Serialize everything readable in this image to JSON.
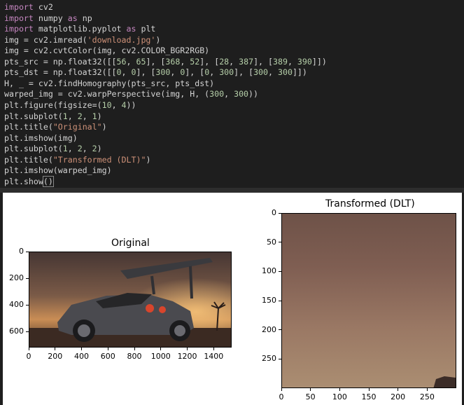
{
  "code": {
    "lines": [
      [
        [
          "kw",
          "import"
        ],
        [
          "txt",
          " cv2"
        ]
      ],
      [
        [
          "kw",
          "import"
        ],
        [
          "txt",
          " numpy "
        ],
        [
          "kw",
          "as"
        ],
        [
          "txt",
          " np"
        ]
      ],
      [
        [
          "kw",
          "import"
        ],
        [
          "txt",
          " matplotlib.pyplot "
        ],
        [
          "kw",
          "as"
        ],
        [
          "txt",
          " plt"
        ]
      ],
      [
        [
          "txt",
          "img = cv2.imread("
        ],
        [
          "st",
          "'download.jpg'"
        ],
        [
          "txt",
          ")"
        ]
      ],
      [
        [
          "txt",
          "img = cv2.cvtColor(img, cv2.COLOR_BGR2RGB)"
        ]
      ],
      [
        [
          "txt",
          "pts_src = np.float32([["
        ],
        [
          "nm",
          "56"
        ],
        [
          "txt",
          ", "
        ],
        [
          "nm",
          "65"
        ],
        [
          "txt",
          "], ["
        ],
        [
          "nm",
          "368"
        ],
        [
          "txt",
          ", "
        ],
        [
          "nm",
          "52"
        ],
        [
          "txt",
          "], ["
        ],
        [
          "nm",
          "28"
        ],
        [
          "txt",
          ", "
        ],
        [
          "nm",
          "387"
        ],
        [
          "txt",
          "], ["
        ],
        [
          "nm",
          "389"
        ],
        [
          "txt",
          ", "
        ],
        [
          "nm",
          "390"
        ],
        [
          "txt",
          "]])"
        ]
      ],
      [
        [
          "txt",
          "pts_dst = np.float32([["
        ],
        [
          "nm",
          "0"
        ],
        [
          "txt",
          ", "
        ],
        [
          "nm",
          "0"
        ],
        [
          "txt",
          "], ["
        ],
        [
          "nm",
          "300"
        ],
        [
          "txt",
          ", "
        ],
        [
          "nm",
          "0"
        ],
        [
          "txt",
          "], ["
        ],
        [
          "nm",
          "0"
        ],
        [
          "txt",
          ", "
        ],
        [
          "nm",
          "300"
        ],
        [
          "txt",
          "], ["
        ],
        [
          "nm",
          "300"
        ],
        [
          "txt",
          ", "
        ],
        [
          "nm",
          "300"
        ],
        [
          "txt",
          "]])"
        ]
      ],
      [
        [
          "txt",
          "H, _ = cv2.findHomography(pts_src, pts_dst)"
        ]
      ],
      [
        [
          "txt",
          "warped_img = cv2.warpPerspective(img, H, ("
        ],
        [
          "nm",
          "300"
        ],
        [
          "txt",
          ", "
        ],
        [
          "nm",
          "300"
        ],
        [
          "txt",
          "))"
        ]
      ],
      [
        [
          "txt",
          "plt.figure(figsize=("
        ],
        [
          "nm",
          "10"
        ],
        [
          "txt",
          ", "
        ],
        [
          "nm",
          "4"
        ],
        [
          "txt",
          "))"
        ]
      ],
      [
        [
          "txt",
          "plt.subplot("
        ],
        [
          "nm",
          "1"
        ],
        [
          "txt",
          ", "
        ],
        [
          "nm",
          "2"
        ],
        [
          "txt",
          ", "
        ],
        [
          "nm",
          "1"
        ],
        [
          "txt",
          ")"
        ]
      ],
      [
        [
          "txt",
          "plt.title("
        ],
        [
          "st",
          "\"Original\""
        ],
        [
          "txt",
          ")"
        ]
      ],
      [
        [
          "txt",
          "plt.imshow(img)"
        ]
      ],
      [
        [
          "txt",
          "plt.subplot("
        ],
        [
          "nm",
          "1"
        ],
        [
          "txt",
          ", "
        ],
        [
          "nm",
          "2"
        ],
        [
          "txt",
          ", "
        ],
        [
          "nm",
          "2"
        ],
        [
          "txt",
          ")"
        ]
      ],
      [
        [
          "txt",
          "plt.title("
        ],
        [
          "st",
          "\"Transformed (DLT)\""
        ],
        [
          "txt",
          ")"
        ]
      ],
      [
        [
          "txt",
          "plt.imshow(warped_img)"
        ]
      ],
      [
        [
          "txt",
          "plt.show"
        ],
        [
          "cur",
          "()"
        ]
      ]
    ]
  },
  "colors": {
    "keyword": "#c586c0",
    "string": "#ce9178",
    "number": "#b5cea8",
    "text": "#d4d4d4",
    "editor_bg": "#1e1e1e",
    "output_bg": "#ffffff"
  },
  "chart_data": [
    {
      "type": "image",
      "title": "Original",
      "xticks": [
        "0",
        "200",
        "400",
        "600",
        "800",
        "1000",
        "1200",
        "1400"
      ],
      "yticks": [
        "0",
        "200",
        "400",
        "600"
      ],
      "xlim": [
        0,
        1536
      ],
      "ylim": [
        720,
        0
      ]
    },
    {
      "type": "image",
      "title": "Transformed (DLT)",
      "xticks": [
        "0",
        "50",
        "100",
        "150",
        "200",
        "250"
      ],
      "yticks": [
        "0",
        "50",
        "100",
        "150",
        "200",
        "250"
      ],
      "xlim": [
        0,
        300
      ],
      "ylim": [
        300,
        0
      ]
    }
  ]
}
